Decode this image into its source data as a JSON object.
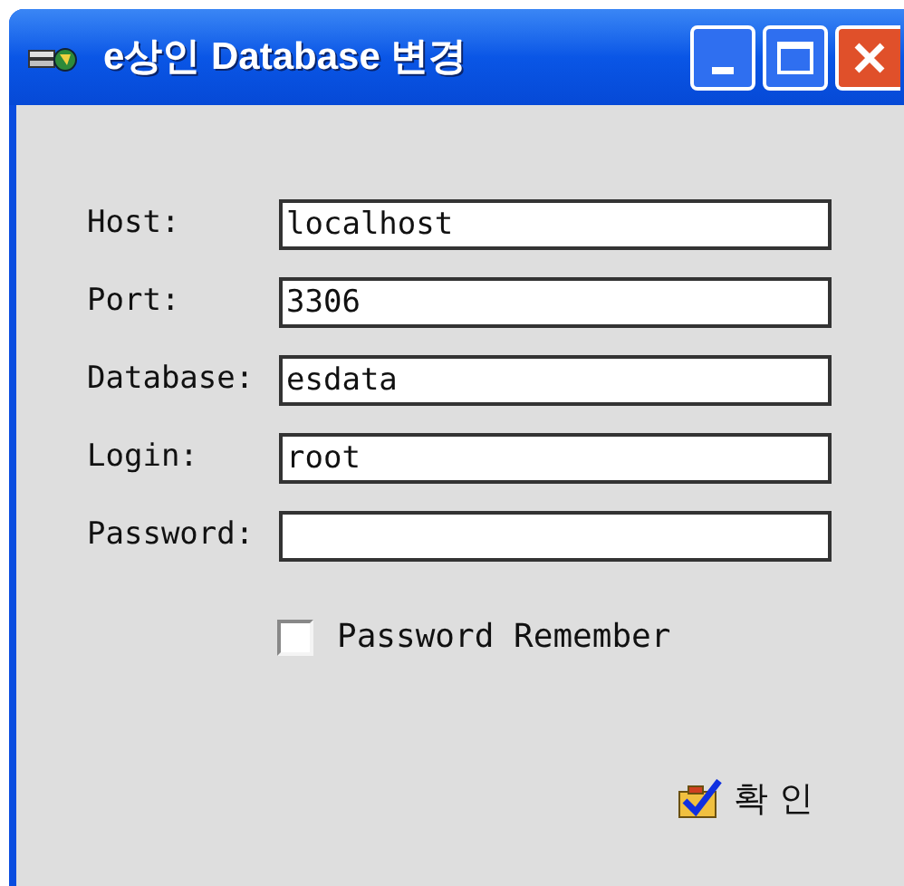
{
  "window": {
    "title": "e상인 Database 변경"
  },
  "fields": [
    {
      "label": "Host:",
      "value": "localhost"
    },
    {
      "label": "Port:",
      "value": "3306"
    },
    {
      "label": "Database:",
      "value": "esdata"
    },
    {
      "label": "Login:",
      "value": "root"
    },
    {
      "label": "Password:"
    }
  ],
  "remember": {
    "label": "Password Remember",
    "checked": false
  },
  "ok_button": {
    "label": "확 인"
  }
}
